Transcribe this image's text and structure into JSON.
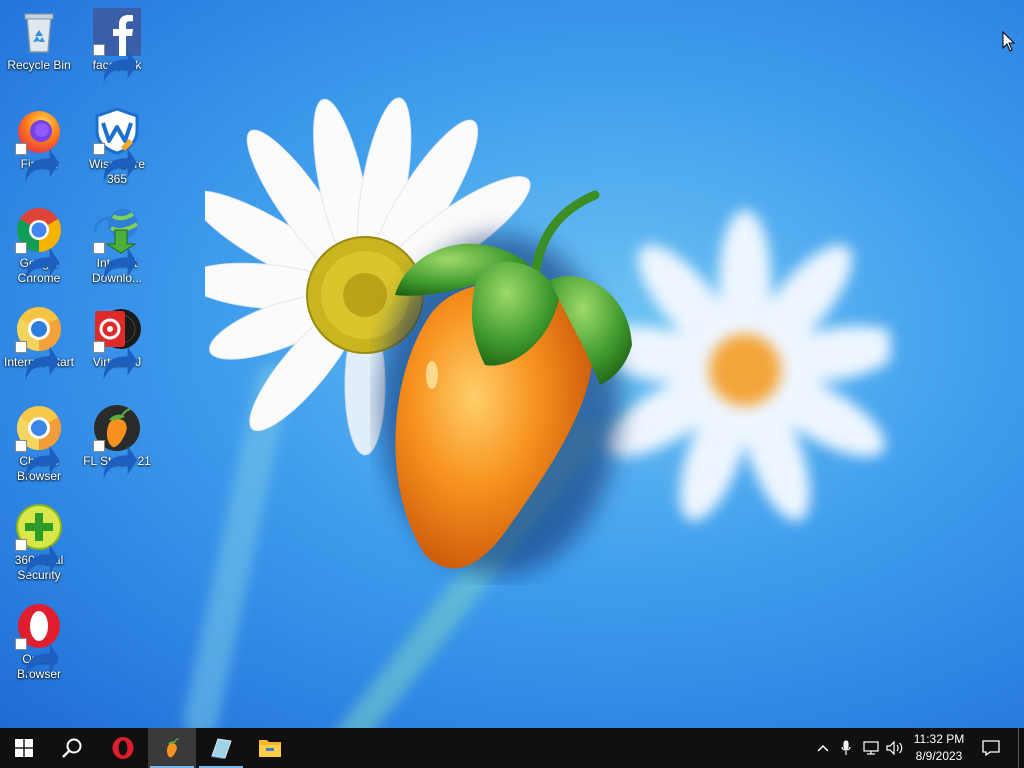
{
  "desktop": {
    "icons": [
      {
        "label": "Recycle Bin",
        "icon": "recycle-bin-icon"
      },
      {
        "label": "facebook",
        "icon": "facebook-icon"
      },
      {
        "label": "Firefox",
        "icon": "firefox-icon"
      },
      {
        "label": "Wise Care 365",
        "icon": "wise-care-icon"
      },
      {
        "label": "Google Chrome",
        "icon": "chrome-icon"
      },
      {
        "label": "Internet Downlo...",
        "icon": "internet-download-manager-icon"
      },
      {
        "label": "Internet-Start",
        "icon": "internet-start-icon"
      },
      {
        "label": "VirtualDJ",
        "icon": "virtualdj-icon"
      },
      {
        "label": "Chrone Browser",
        "icon": "chrone-browser-icon"
      },
      {
        "label": "FL Studio 21",
        "icon": "fl-studio-icon"
      },
      {
        "label": "360 Total Security",
        "icon": "360-security-icon"
      },
      {
        "label": "Opera Browser",
        "icon": "opera-icon"
      }
    ]
  },
  "taskbar": {
    "pinned": [
      {
        "icon": "windows-start-icon"
      },
      {
        "icon": "search-icon"
      },
      {
        "icon": "opera-icon"
      },
      {
        "icon": "fl-studio-icon",
        "active": true
      },
      {
        "icon": "app-icon"
      },
      {
        "icon": "file-explorer-icon"
      }
    ],
    "tray": [
      "chevron-up-icon",
      "microphone-icon",
      "network-icon",
      "volume-icon"
    ],
    "clock": {
      "time": "11:32 PM",
      "date": "8/9/2023"
    },
    "notification_icon": "notification-icon"
  },
  "colors": {
    "taskbar_bg": "#101010",
    "wallpaper_blue": "#3f9ded",
    "active_underline": "#76b9ed"
  }
}
